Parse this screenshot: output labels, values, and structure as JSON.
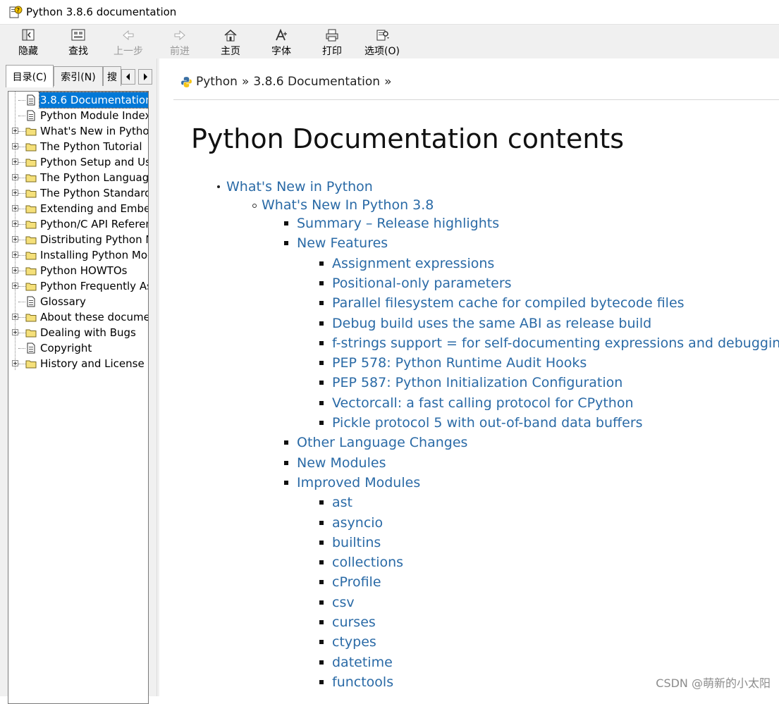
{
  "window": {
    "title": "Python 3.8.6 documentation"
  },
  "toolbar": {
    "buttons": [
      {
        "label": "隐藏",
        "icon": "hide-pane-icon",
        "enabled": true
      },
      {
        "label": "查找",
        "icon": "locate-icon",
        "enabled": true
      },
      {
        "label": "上一步",
        "icon": "back-arrow-icon",
        "enabled": false
      },
      {
        "label": "前进",
        "icon": "forward-arrow-icon",
        "enabled": false
      },
      {
        "label": "主页",
        "icon": "home-icon",
        "enabled": true
      },
      {
        "label": "字体",
        "icon": "font-icon",
        "enabled": true
      },
      {
        "label": "打印",
        "icon": "printer-icon",
        "enabled": true
      },
      {
        "label": "选项(O)",
        "icon": "options-icon",
        "enabled": true
      }
    ]
  },
  "nav_tabs": {
    "tabs": [
      {
        "label": "目录(C)",
        "active": true
      },
      {
        "label": "索引(N)",
        "active": false
      },
      {
        "label": "搜",
        "active": false
      }
    ]
  },
  "tree": {
    "items": [
      {
        "label": "3.8.6 Documentation",
        "type": "page",
        "expandable": false,
        "selected": true
      },
      {
        "label": "Python Module Index",
        "type": "page",
        "expandable": false,
        "selected": false
      },
      {
        "label": "What's New in Python",
        "type": "folder",
        "expandable": true,
        "selected": false
      },
      {
        "label": "The Python Tutorial",
        "type": "folder",
        "expandable": true,
        "selected": false
      },
      {
        "label": "Python Setup and Usage",
        "type": "folder",
        "expandable": true,
        "selected": false
      },
      {
        "label": "The Python Language Reference",
        "type": "folder",
        "expandable": true,
        "selected": false
      },
      {
        "label": "The Python Standard Library",
        "type": "folder",
        "expandable": true,
        "selected": false
      },
      {
        "label": "Extending and Embedding",
        "type": "folder",
        "expandable": true,
        "selected": false
      },
      {
        "label": "Python/C API Reference",
        "type": "folder",
        "expandable": true,
        "selected": false
      },
      {
        "label": "Distributing Python Modules",
        "type": "folder",
        "expandable": true,
        "selected": false
      },
      {
        "label": "Installing Python Modules",
        "type": "folder",
        "expandable": true,
        "selected": false
      },
      {
        "label": "Python HOWTOs",
        "type": "folder",
        "expandable": true,
        "selected": false
      },
      {
        "label": "Python Frequently Asked Questions",
        "type": "folder",
        "expandable": true,
        "selected": false
      },
      {
        "label": "Glossary",
        "type": "page",
        "expandable": false,
        "selected": false
      },
      {
        "label": "About these documents",
        "type": "folder",
        "expandable": true,
        "selected": false
      },
      {
        "label": "Dealing with Bugs",
        "type": "folder",
        "expandable": true,
        "selected": false
      },
      {
        "label": "Copyright",
        "type": "page",
        "expandable": false,
        "selected": false
      },
      {
        "label": "History and License",
        "type": "folder",
        "expandable": true,
        "selected": false
      }
    ]
  },
  "content": {
    "breadcrumb": [
      "Python",
      "3.8.6 Documentation"
    ],
    "breadcrumb_sep": "»",
    "title": "Python Documentation contents",
    "toc": [
      {
        "label": "What's New in Python",
        "level": 1
      },
      {
        "label": "What's New In Python 3.8",
        "level": 2
      },
      {
        "label": "Summary – Release highlights",
        "level": 3
      },
      {
        "label": "New Features",
        "level": 3
      },
      {
        "label": "Assignment expressions",
        "level": 4
      },
      {
        "label": "Positional-only parameters",
        "level": 4
      },
      {
        "label": "Parallel filesystem cache for compiled bytecode files",
        "level": 4
      },
      {
        "label": "Debug build uses the same ABI as release build",
        "level": 4
      },
      {
        "label": "f-strings support = for self-documenting expressions and debugging",
        "level": 4
      },
      {
        "label": "PEP 578: Python Runtime Audit Hooks",
        "level": 4
      },
      {
        "label": "PEP 587: Python Initialization Configuration",
        "level": 4
      },
      {
        "label": "Vectorcall: a fast calling protocol for CPython",
        "level": 4
      },
      {
        "label": "Pickle protocol 5 with out-of-band data buffers",
        "level": 4
      },
      {
        "label": "Other Language Changes",
        "level": 3
      },
      {
        "label": "New Modules",
        "level": 3
      },
      {
        "label": "Improved Modules",
        "level": 3
      },
      {
        "label": "ast",
        "level": 4
      },
      {
        "label": "asyncio",
        "level": 4
      },
      {
        "label": "builtins",
        "level": 4
      },
      {
        "label": "collections",
        "level": 4
      },
      {
        "label": "cProfile",
        "level": 4
      },
      {
        "label": "csv",
        "level": 4
      },
      {
        "label": "curses",
        "level": 4
      },
      {
        "label": "ctypes",
        "level": 4
      },
      {
        "label": "datetime",
        "level": 4
      },
      {
        "label": "functools",
        "level": 4
      }
    ]
  },
  "watermark": "CSDN @萌新的小太阳",
  "colors": {
    "link": "#2a6aa6",
    "selection": "#0078d7",
    "chrome": "#f0f0f0"
  }
}
